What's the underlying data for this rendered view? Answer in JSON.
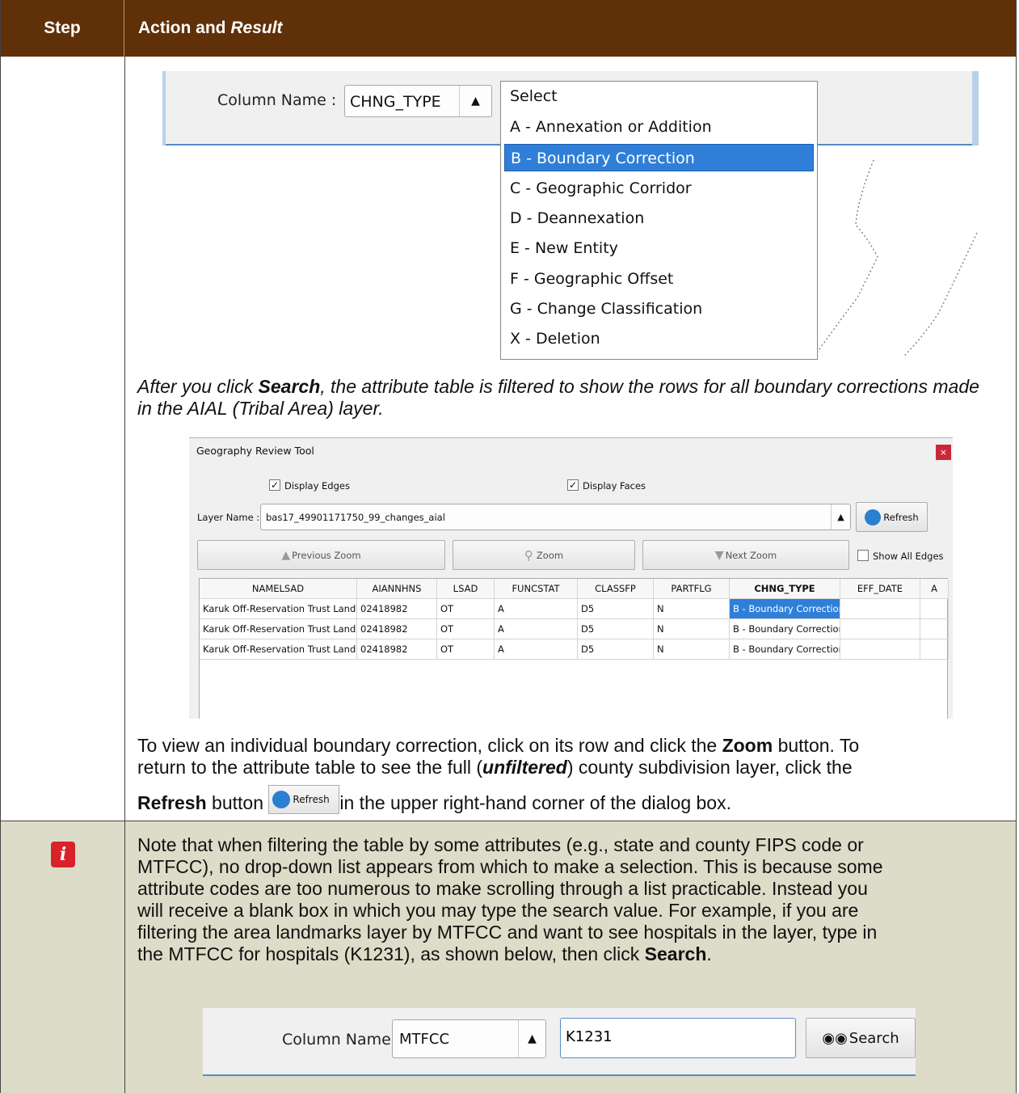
{
  "header": {
    "col1": "Step",
    "col2_a": "Action and ",
    "col2_b": "Result"
  },
  "row1": {
    "dropdown_shot": {
      "column_label": "Column Name :",
      "combo_value": "CHNG_TYPE",
      "options": [
        "Select",
        "A - Annexation or Addition",
        "B - Boundary Correction",
        "C - Geographic Corridor",
        "D - Deannexation",
        "E - New Entity",
        "F - Geographic Offset",
        "G - Change Classification",
        "X - Deletion"
      ],
      "selected_index": 2
    },
    "para1": {
      "a": "After you click ",
      "b": "Search",
      "c": ", the attribute table is filtered to show the rows for all boundary corrections made in the AIAL (Tribal Area) layer."
    },
    "tool": {
      "title": "Geography Review Tool",
      "close": "×",
      "display_edges": "Display Edges",
      "display_faces": "Display Faces",
      "layer_label": "Layer Name :",
      "layer_value": "bas17_49901171750_99_changes_aial",
      "refresh": "Refresh",
      "prev_zoom": "Previous Zoom",
      "zoom": "Zoom",
      "next_zoom": "Next Zoom",
      "show_all_edges": "Show All Edges",
      "columns": [
        "NAMELSAD",
        "AIANNHNS",
        "LSAD",
        "FUNCSTAT",
        "CLASSFP",
        "PARTFLG",
        "CHNG_TYPE",
        "EFF_DATE",
        "A"
      ],
      "rows": [
        [
          "Karuk Off-Reservation Trust Land",
          "02418982",
          "OT",
          "A",
          "D5",
          "N",
          "B - Boundary Correction",
          ""
        ],
        [
          "Karuk Off-Reservation Trust Land",
          "02418982",
          "OT",
          "A",
          "D5",
          "N",
          "B - Boundary Correction",
          ""
        ],
        [
          "Karuk Off-Reservation Trust Land",
          "02418982",
          "OT",
          "A",
          "D5",
          "N",
          "B - Boundary Correction",
          ""
        ]
      ]
    },
    "para2": {
      "a": "To view an individual boundary correction, click on its row and click the ",
      "b": "Zoom",
      "c": " button. To",
      "d": "return to the attribute table to see the full (",
      "e": "unfiltered",
      "f": ") county subdivision layer, click the",
      "g": "Refresh",
      "h": " button ",
      "i": "Refresh",
      "j": "in the upper right-hand corner of the dialog box."
    }
  },
  "row2": {
    "note_icon": "info-icon",
    "note": {
      "l1": "Note that when filtering the table by some attributes (e.g., state and county FIPS code or",
      "l2": "MTFCC), no drop-down list appears from which to make a selection. This is because some",
      "l3": "attribute codes are too numerous to make scrolling through a list practicable. Instead you",
      "l4": "will receive a blank box in which you may type the search value. For example, if you are",
      "l5": "filtering the area landmarks layer by MTFCC and want to see hospitals in the layer, type in",
      "l6a": "the MTFCC for hospitals (K1231), as shown below, then click ",
      "l6b": "Search",
      "l6c": "."
    },
    "search_shot": {
      "column_label": "Column Name :",
      "combo_value": "MTFCC",
      "input_value": "K1231",
      "search_button": "Search"
    }
  },
  "colors": {
    "header_bg": "#603009",
    "note_bg": "#dcdcc8",
    "selection": "#2f7fd8"
  }
}
